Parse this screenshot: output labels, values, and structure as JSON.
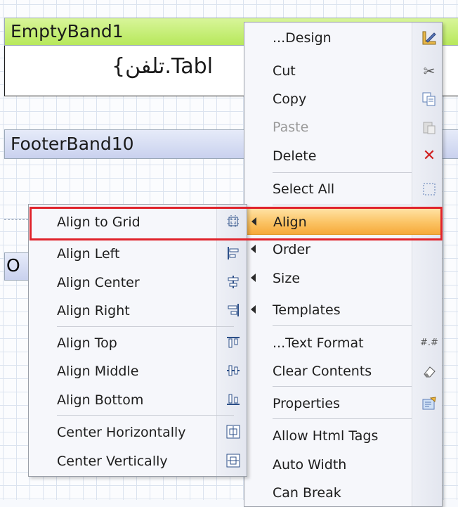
{
  "designer": {
    "bands": {
      "empty_band": "EmptyBand1",
      "footer_band": "FooterBand10",
      "other_band": "O"
    },
    "text_object_value": "{تلفن.Tabl"
  },
  "context_menu": {
    "items": [
      {
        "label": "...Design",
        "icon": "design-ruler-icon"
      },
      {
        "label": "Cut",
        "icon": "scissors-icon"
      },
      {
        "label": "Copy",
        "icon": "copy-icon"
      },
      {
        "label": "Paste",
        "icon": "paste-icon",
        "disabled": true
      },
      {
        "label": "Delete",
        "icon": "delete-x-icon"
      },
      {
        "label": "Select All",
        "icon": "select-all-icon"
      },
      {
        "label": "Align",
        "submenu": true,
        "highlighted": true
      },
      {
        "label": "Order",
        "submenu": true
      },
      {
        "label": "Size",
        "submenu": true
      },
      {
        "label": "Templates",
        "submenu": true
      },
      {
        "label": "...Text Format",
        "icon": "hash-format-icon"
      },
      {
        "label": "Clear Contents",
        "icon": "eraser-icon"
      },
      {
        "label": "Properties",
        "icon": "properties-icon"
      },
      {
        "label": "Allow Html Tags"
      },
      {
        "label": "Auto Width"
      },
      {
        "label": "Can Break"
      }
    ],
    "glyphs": {
      "cut": "✂",
      "delete": "✕",
      "hash": "#.#"
    }
  },
  "align_submenu": {
    "items": [
      {
        "label": "Align to Grid",
        "icon": "align-to-grid-icon"
      },
      {
        "label": "Align Left",
        "icon": "align-left-icon"
      },
      {
        "label": "Align Center",
        "icon": "align-center-icon"
      },
      {
        "label": "Align Right",
        "icon": "align-right-icon"
      },
      {
        "label": "Align Top",
        "icon": "align-top-icon"
      },
      {
        "label": "Align Middle",
        "icon": "align-middle-icon"
      },
      {
        "label": "Align Bottom",
        "icon": "align-bottom-icon"
      },
      {
        "label": "Center Horizontally",
        "icon": "center-horizontally-icon"
      },
      {
        "label": "Center Vertically",
        "icon": "center-vertically-icon"
      }
    ]
  },
  "colors": {
    "highlight_border": "#e0232b",
    "active_item": "#f6a93a",
    "empty_band": "#b7e85b",
    "footer_band": "#c9d1ee"
  }
}
